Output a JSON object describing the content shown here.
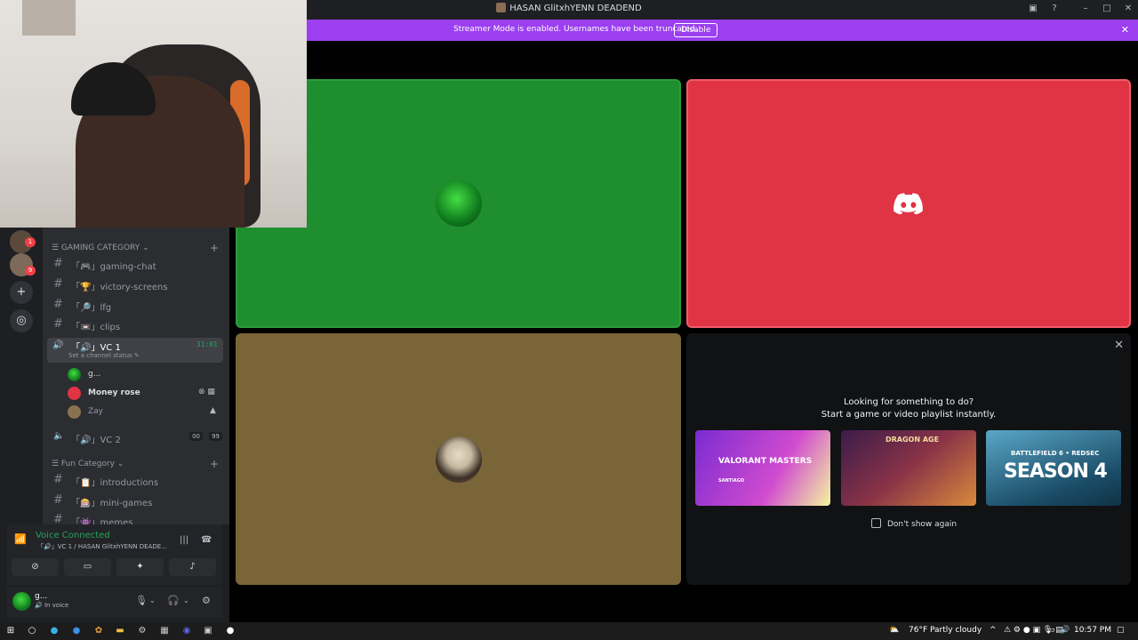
{
  "window": {
    "title": "HASAN GlitxhYENN DEADEND",
    "controls": [
      "inbox-icon",
      "help-icon",
      "minimize-icon",
      "maximize-icon",
      "close-icon"
    ]
  },
  "banner": {
    "message": "Streamer Mode is enabled. Usernames have been truncated.",
    "button": "Disable",
    "close": "✕",
    "color": "#9b3ff0"
  },
  "servers": {
    "badges": [
      "1",
      "9"
    ],
    "add": "+",
    "explore": "explore-icon"
  },
  "category_gaming": {
    "label": "☰ GAMING CATEGORY ⌄",
    "add": "+",
    "channels": [
      {
        "hash": "#",
        "name": "「🎮」gaming-chat"
      },
      {
        "hash": "#",
        "name": "「🏆」victory-screens"
      },
      {
        "hash": "#",
        "name": "「🔎」lfg"
      },
      {
        "hash": "#",
        "name": "「📼」clips"
      }
    ]
  },
  "vc1": {
    "speaker": "🔊",
    "name": "「🔊」VC 1",
    "time": "31:01",
    "status": "Set a channel status ✎",
    "members": [
      {
        "name": "g...",
        "icons": ""
      },
      {
        "name": "Money rose",
        "icons": "⊗ ▦"
      },
      {
        "name": "Zay",
        "icons": "▲"
      }
    ]
  },
  "vc2": {
    "speaker": "🔈",
    "name": "「🔊」VC 2",
    "count_a": "00",
    "count_b": "99"
  },
  "category_fun": {
    "label": "☰ Fun Category ⌄",
    "add": "+",
    "channels": [
      {
        "hash": "#",
        "name": "「📋」introductions"
      },
      {
        "hash": "#",
        "name": "「🎰」mini-games"
      },
      {
        "hash": "#",
        "name": "「👾」memes"
      }
    ]
  },
  "voice": {
    "title": "Voice Connected",
    "subtitle": "「🔊」VC 1 / HASAN GlitxhYENN DEADE...",
    "buttons": [
      "camera-off-icon",
      "screen-share-icon",
      "activities-icon",
      "soundboard-icon"
    ]
  },
  "user": {
    "name": "g...",
    "status": "🔊 In voice"
  },
  "stage": {
    "tiles": [
      {
        "color": "#1e8e2e",
        "kind": "avatar-green"
      },
      {
        "color": "#e03445",
        "kind": "discord-logo"
      },
      {
        "color": "#7a6538",
        "kind": "avatar-user"
      }
    ]
  },
  "activity": {
    "heading1": "Looking for something to do?",
    "heading2": "Start a game or video playlist instantly.",
    "close": "✕",
    "games": [
      {
        "title": "VALORANT MASTERS",
        "sub": "SANTIAGO"
      },
      {
        "title": "DRAGON AGE"
      },
      {
        "title_small": "BATTLEFIELD 6 • REDSEC",
        "title": "SEASON 4"
      }
    ],
    "dont_show": "Don't show again"
  },
  "taskbar": {
    "weather": "76°F  Partly cloudy",
    "clock": "10:57 PM"
  }
}
